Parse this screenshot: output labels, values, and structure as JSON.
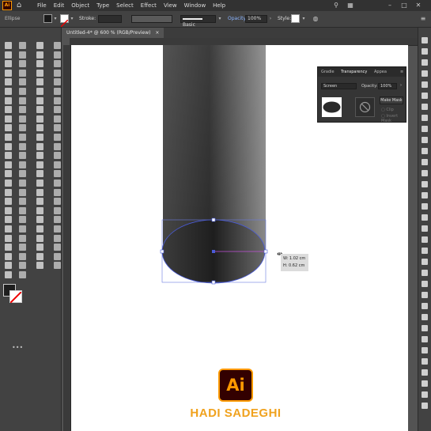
{
  "app": {
    "menu": [
      "File",
      "Edit",
      "Object",
      "Type",
      "Select",
      "Effect",
      "View",
      "Window",
      "Help"
    ],
    "logo_text": "Ai"
  },
  "control_bar": {
    "selection_label": "Ellipse",
    "stroke_label": "Stroke:",
    "brush_label": "Basic",
    "opacity_label": "Opacity:",
    "opacity_value": "100%",
    "style_label": "Style:"
  },
  "document": {
    "tab_title": "Untitled-4* @ 600 % (RGB/Preview)",
    "close_glyph": "×"
  },
  "transparency_panel": {
    "tabs": [
      "Gradie",
      "Transparency",
      "Appea"
    ],
    "blend_mode": "Screen",
    "opacity_label": "Opacity:",
    "opacity_value": "100%",
    "make_mask_label": "Make Mask",
    "clip_label": "Clip",
    "invert_label": "Invert Mask"
  },
  "tooltip": {
    "width": "W: 1.02 cm",
    "height": "H: 0.62 cm"
  },
  "branding": {
    "logo_text": "Ai",
    "author": "HADI SADEGHI"
  },
  "colors": {
    "accent": "#ff9a00",
    "author_text": "#f0a21e",
    "selection": "#4a5bd8"
  }
}
